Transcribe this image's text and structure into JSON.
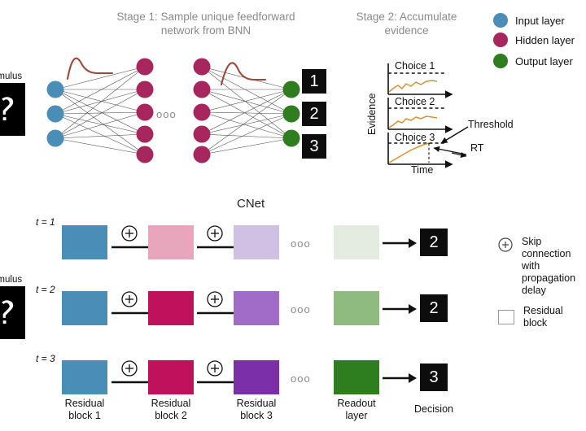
{
  "figure": {
    "stage1_title": "Stage 1: Sample unique feedforward network from BNN",
    "stage2_title": "Stage 2: Accumulate evidence",
    "cnet_title": "CNet",
    "stimulus_label": "Stimulus",
    "ellipsis": "ooo"
  },
  "legend_top": {
    "items": [
      {
        "label": "Input layer",
        "color": "#4a8db7"
      },
      {
        "label": "Hidden layer",
        "color": "#a8265e"
      },
      {
        "label": "Output layer",
        "color": "#2e7d1e"
      }
    ]
  },
  "legend_right": {
    "skip_icon": "plus-circle-icon",
    "skip_label": "Skip connection with propagation delay",
    "skip_line1": "Skip connection",
    "skip_line2": "with propagation",
    "skip_line3": "delay",
    "residual_label": "Residual block"
  },
  "bnn": {
    "input_nodes": 3,
    "hidden_nodes": 5,
    "output_nodes": 3,
    "input_color": "#4a8db7",
    "hidden_color": "#a8265e",
    "output_color": "#2e7d1e",
    "weight_curve_color": "#9c4a3c",
    "decisions": [
      "1",
      "2",
      "3"
    ]
  },
  "evidence_plot": {
    "ylabel": "Evidence",
    "xlabel": "Time",
    "trace_color": "#d6932f",
    "panels": [
      {
        "label": "Choice 1",
        "threshold_reached": false
      },
      {
        "label": "Choice 2",
        "threshold_reached": false
      },
      {
        "label": "Choice 3",
        "threshold_reached": true
      }
    ],
    "annotations": [
      "Threshold",
      "RT"
    ]
  },
  "cnet": {
    "column_labels": [
      "Residual block 1",
      "Residual block 2",
      "Residual block 3",
      "Readout layer",
      "Decision"
    ],
    "column_label_lines": [
      [
        "Residual",
        "block 1"
      ],
      [
        "Residual",
        "block 2"
      ],
      [
        "Residual",
        "block 3"
      ],
      [
        "Readout",
        "layer"
      ],
      [
        "Decision"
      ]
    ],
    "skip_symbol": "+",
    "rows": [
      {
        "time_label": "t = 1",
        "time_value": "1",
        "blocks": [
          "#4a8db7",
          "#e8a6bc",
          "#cfc0e4"
        ],
        "readout": "#e4ebe0",
        "decision": "2"
      },
      {
        "time_label": "t = 2",
        "time_value": "2",
        "blocks": [
          "#4a8db7",
          "#c0125c",
          "#a06cc8"
        ],
        "readout": "#8fbb80",
        "decision": "2"
      },
      {
        "time_label": "t = 3",
        "time_value": "3",
        "blocks": [
          "#4a8db7",
          "#c0125c",
          "#7b2fa8"
        ],
        "readout": "#2e7d1e",
        "decision": "3"
      }
    ]
  },
  "chart_data": {
    "type": "line",
    "title": "Stage 2: Accumulate evidence",
    "xlabel": "Time",
    "ylabel": "Evidence",
    "grid": false,
    "legend": "none",
    "series": [
      {
        "name": "Choice 1",
        "threshold": 1.0,
        "crosses_threshold": false,
        "x": [
          0,
          1,
          2,
          3,
          4,
          5,
          6,
          7,
          8,
          9,
          10
        ],
        "y": [
          0.05,
          0.18,
          0.3,
          0.27,
          0.38,
          0.33,
          0.46,
          0.42,
          0.52,
          0.55,
          0.54
        ]
      },
      {
        "name": "Choice 2",
        "threshold": 1.0,
        "crosses_threshold": false,
        "x": [
          0,
          1,
          2,
          3,
          4,
          5,
          6,
          7,
          8,
          9,
          10
        ],
        "y": [
          0.04,
          0.12,
          0.22,
          0.2,
          0.31,
          0.28,
          0.39,
          0.36,
          0.44,
          0.41,
          0.4
        ]
      },
      {
        "name": "Choice 3",
        "threshold": 1.0,
        "crosses_threshold": true,
        "x": [
          0,
          1,
          2,
          3,
          4,
          5,
          6,
          7,
          8,
          9,
          10
        ],
        "y": [
          0.03,
          0.14,
          0.24,
          0.33,
          0.44,
          0.53,
          0.63,
          0.74,
          0.84,
          0.94,
          1.0
        ]
      }
    ]
  }
}
